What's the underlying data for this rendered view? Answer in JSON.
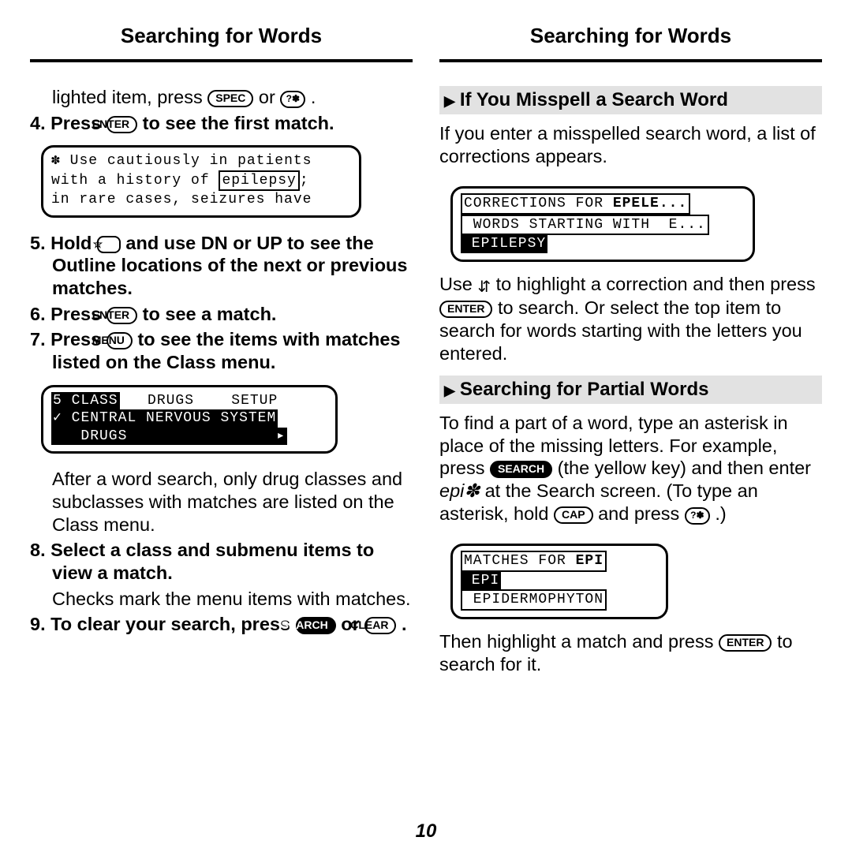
{
  "header": {
    "left": "Searching for Words",
    "right": "Searching for Words"
  },
  "pagenum": "10",
  "keys": {
    "spec": "SPEC",
    "enter": "ENTER",
    "menu": "MENU",
    "search": "SEARCH",
    "clear": "CLEAR",
    "cap": "CAP",
    "qmark": "?✽",
    "star": "☆",
    "scroll": "⇵"
  },
  "left": {
    "lead_a": "lighted item, press ",
    "lead_b": " or ",
    "lead_c": " .",
    "s4a": "4. Press ",
    "s4b": " to see the first match.",
    "lcd1": {
      "l1a": "✽ Use cautiously in patients",
      "l2a": "with a history of ",
      "l2box": "epilepsy",
      "l2b": ";",
      "l3a": "in rare cases, seizures have"
    },
    "s5a": "5. Hold ",
    "s5b": " and use DN or UP to see the Outline locations of the next or previous matches.",
    "s6a": "6. Press ",
    "s6b": " to see a match.",
    "s7a": "7. Press ",
    "s7b": " to see the items with matches listed on the Class menu.",
    "lcd2": {
      "tab1": "5 CLASS",
      "tab2": "DRUGS",
      "tab3": "SETUP",
      "row1": " CENTRAL NERVOUS SYSTEM",
      "row2": "   DRUGS                ▸"
    },
    "p_after": "After a word search, only drug classes and subclasses with matches are listed on the Class menu.",
    "s8": "8. Select a class and submenu items to view a match.",
    "p_checks": "Checks mark the menu items with matches.",
    "s9a": "9. To clear your search, press ",
    "s9b": " or ",
    "s9c": " ."
  },
  "right": {
    "sect1": "If You Misspell a Search Word",
    "p1": "If you enter a misspelled search word, a list of corrections appears.",
    "lcd3": {
      "l1a": "CORRECTIONS FOR ",
      "l1b": "EPELE...",
      "l2a": " WORDS STARTING WITH  E...",
      "l3a": " EPILEPSY"
    },
    "p2a": "Use ",
    "p2b": " to highlight a correction and then press ",
    "p2c": " to search. Or select the top item to search for words starting with the letters you entered.",
    "sect2": "Searching for Partial Words",
    "p3a": "To find a part of a word, type an asterisk in place of the missing letters. For example, press ",
    "p3b": " (the yellow key) and then enter ",
    "p3c": "epi✽",
    "p3d": " at the Search screen. (To type an asterisk, hold ",
    "p3e": " and press ",
    "p3f": " .)",
    "lcd4": {
      "l1a": "MATCHES FOR ",
      "l1b": "EPI",
      "l2": " EPI",
      "l3": " EPIDERMOPHYTON"
    },
    "p4a": "Then highlight a match and press ",
    "p4b": " to search for it."
  }
}
